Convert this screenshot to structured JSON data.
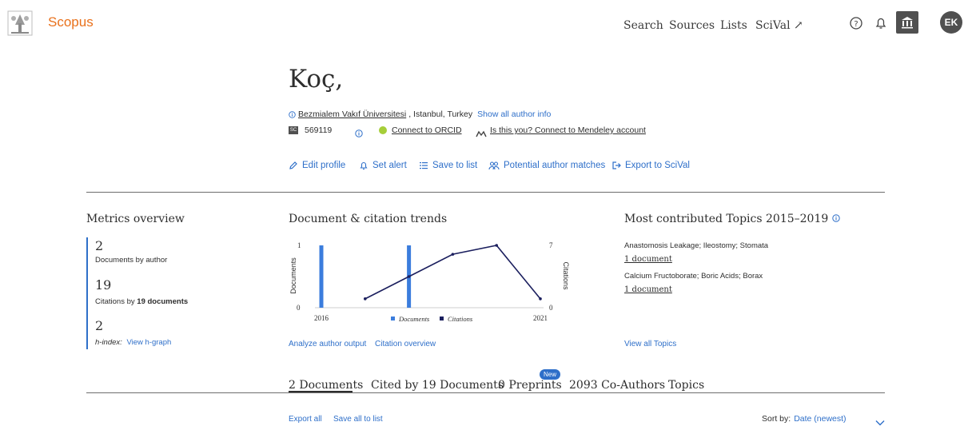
{
  "header": {
    "brand": "Scopus",
    "nav": [
      "Search",
      "Sources",
      "Lists",
      "SciVal ↗"
    ],
    "avatar_initials": "EK"
  },
  "author": {
    "name": "Koç,",
    "affiliation": "Bezmialem Vakıf Üniversitesi",
    "location": ", Istanbul, Turkey",
    "show_all_info": "Show all author info",
    "scopus_id": "569119",
    "scopus_badge": "SC",
    "connect_orcid": "Connect to ORCID",
    "mendeley": "Is this you? Connect to Mendeley account"
  },
  "actions": [
    "Edit profile",
    "Set alert",
    "Save to list",
    "Potential author matches",
    "Export to SciVal"
  ],
  "metrics": {
    "title": "Metrics overview",
    "docs_count": "2",
    "docs_label": "Documents by author",
    "citations_count": "19",
    "citations_label_prefix": "Citations by ",
    "citations_label_bold": "19 documents",
    "hindex_count": "2",
    "hindex_label": "h-index:",
    "view_hgraph": "View h-graph"
  },
  "trends": {
    "title": "Document & citation trends",
    "analyze_link": "Analyze author output",
    "overview_link": "Citation overview"
  },
  "chart_data": {
    "type": "bar",
    "x_range": [
      2016,
      2021
    ],
    "xlabel_ticks": [
      "2016",
      "2021"
    ],
    "ylabel_left": "Documents",
    "ylabel_right": "Citations",
    "left_axis_ticks": [
      "1",
      "0"
    ],
    "right_axis_ticks": [
      "7",
      "0"
    ],
    "series": [
      {
        "name": "Documents",
        "axis": "left",
        "kind": "bar",
        "x": [
          2016,
          2018
        ],
        "values": [
          1,
          1
        ],
        "color": "#3b7ddd"
      },
      {
        "name": "Citations",
        "axis": "right",
        "kind": "line",
        "x": [
          2017,
          2018,
          2019,
          2020,
          2021
        ],
        "values": [
          1,
          3.5,
          6,
          7,
          1
        ],
        "color": "#1b1f5e"
      }
    ],
    "legend_position": "bottom"
  },
  "topics": {
    "title": "Most contributed Topics 2015–2019",
    "items": [
      {
        "name": "Anastomosis Leakage; Ileostomy; Stomata",
        "docs": "1 document"
      },
      {
        "name": "Calcium Fructoborate; Boric Acids; Borax",
        "docs": "1 document"
      }
    ],
    "view_all": "View all Topics"
  },
  "tabs": {
    "documents": "2 Documents",
    "cited_by": "Cited by 19 Documents",
    "preprints": "0 Preprints",
    "new_badge": "New",
    "coauthors": "2093 Co-Authors",
    "topics": "Topics"
  },
  "list_controls": {
    "export_all": "Export all",
    "save_all": "Save all to list",
    "sort_label": "Sort by:",
    "sort_value": "Date (newest)"
  },
  "colors": {
    "brand": "#e9711c",
    "link": "#2e6fc9",
    "bar": "#3b7ddd",
    "line": "#1b1f5e"
  }
}
